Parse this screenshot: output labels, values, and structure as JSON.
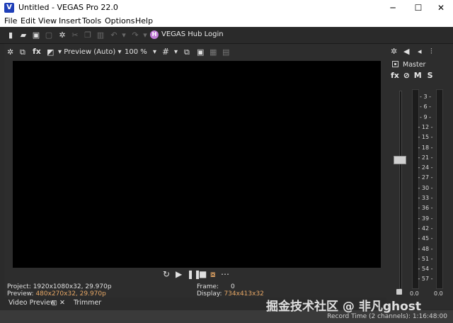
{
  "window": {
    "title": "Untitled - VEGAS Pro 22.0",
    "app_icon_letter": "V",
    "minimize": "─",
    "maximize": "☐",
    "close": "✕"
  },
  "menu": [
    "File",
    "Edit",
    "View",
    "Insert",
    "Tools",
    "Options",
    "Help"
  ],
  "toolbar": {
    "hub_icon_letter": "H",
    "hub_label": "VEGAS Hub Login"
  },
  "preview": {
    "quality_label": "Preview (Auto)",
    "zoom_label": "100 %",
    "project_label": "Project:",
    "project_value": "1920x1080x32, 29.970p",
    "preview_label": "Preview:",
    "preview_value": "480x270x32, 29.970p",
    "frame_label": "Frame:",
    "frame_value": "0",
    "display_label": "Display:",
    "display_value": "734x413x32"
  },
  "tabs": {
    "video_preview": "Video Preview",
    "trimmer": "Trimmer"
  },
  "mixer": {
    "master_label": "Master",
    "fx_label": "fx",
    "mute_label": "M",
    "solo_label": "S",
    "scale": [
      "3",
      "6",
      "9",
      "12",
      "15",
      "18",
      "21",
      "24",
      "27",
      "30",
      "33",
      "36",
      "39",
      "42",
      "45",
      "48",
      "51",
      "54",
      "57"
    ],
    "left_level": "0.0",
    "right_level": "0.0",
    "bottom_label": "0.0"
  },
  "status": {
    "record_time": "Record Time (2 channels): 1:16:48:00"
  },
  "watermark": "掘金技术社区 @ 非凡ghost"
}
